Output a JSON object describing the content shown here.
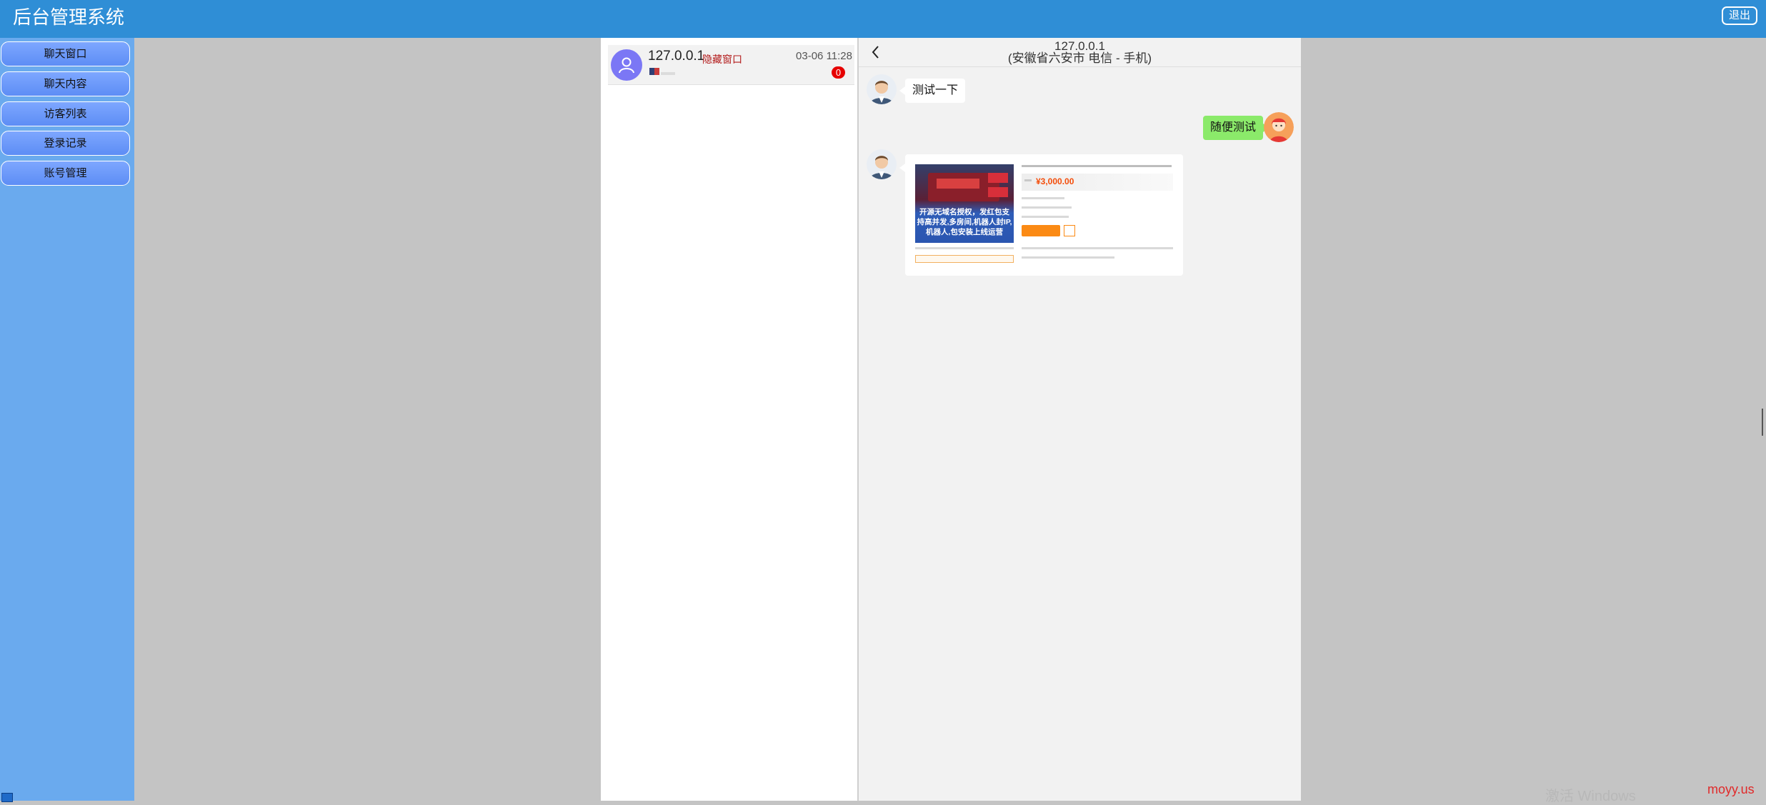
{
  "header": {
    "title": "后台管理系统",
    "logout_label": "退出"
  },
  "sidebar": {
    "items": [
      {
        "label": "聊天窗口"
      },
      {
        "label": "聊天内容"
      },
      {
        "label": "访客列表"
      },
      {
        "label": "登录记录"
      },
      {
        "label": "账号管理"
      }
    ]
  },
  "session": {
    "ip": "127.0.0.1",
    "hide_label": "隐藏窗口",
    "time": "03-06 11:28",
    "unread": "0"
  },
  "chat": {
    "ip": "127.0.0.1",
    "location": "(安徽省六安市 电信 - 手机)",
    "messages": [
      {
        "side": "left",
        "text": "测试一下"
      },
      {
        "side": "right",
        "text": "随便测试"
      }
    ],
    "card": {
      "image_text": "开源无域名授权，发红包支持高并发,多房间,机器人封IP,机器人,包安装上线运营",
      "price": "¥3,000.00"
    }
  },
  "watermark": {
    "windows": "激活 Windows",
    "site": "moyy.us"
  },
  "colors": {
    "topbar": "#2f8ed6",
    "sidebar": "#6aaaee",
    "nav_button": "#6d9af8",
    "right_bubble": "#8bea6a",
    "badge": "#e60000"
  }
}
